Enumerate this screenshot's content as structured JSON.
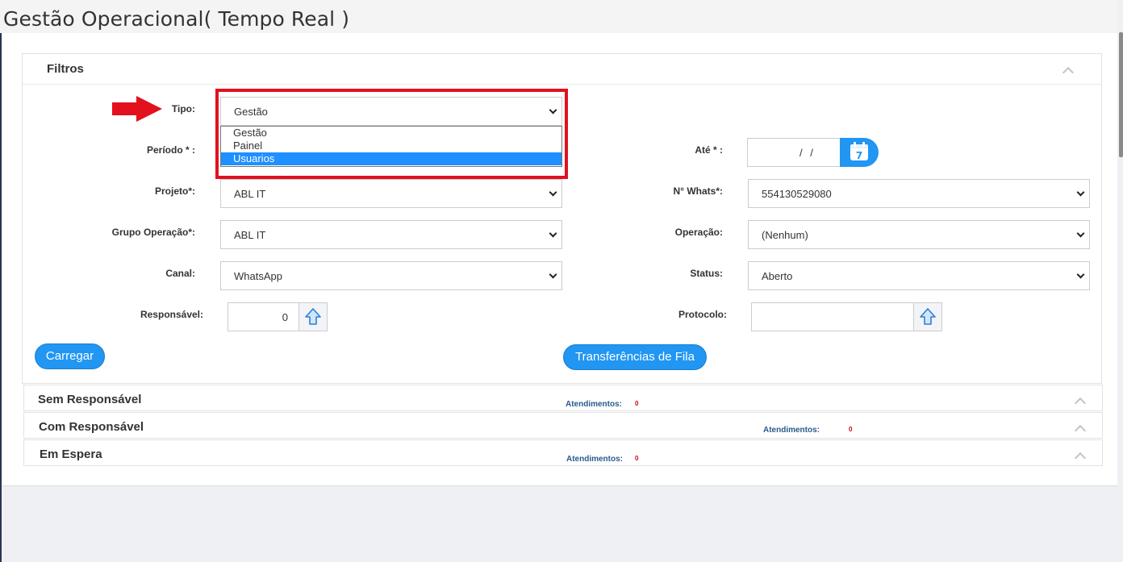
{
  "page": {
    "title": "Gestão Operacional( Tempo Real )"
  },
  "filters": {
    "title": "Filtros",
    "tipo": {
      "label": "Tipo:",
      "value": "Gestão",
      "options": [
        "Gestão",
        "Painel",
        "Usuarios"
      ],
      "highlighted": "Usuarios"
    },
    "periodo": {
      "label": "Período * :"
    },
    "ate": {
      "label": "Até * :",
      "value": "/ /"
    },
    "projeto": {
      "label": "Projeto*:",
      "value": "ABL IT"
    },
    "whats": {
      "label": "N° Whats*:",
      "value": "554130529080"
    },
    "grupo": {
      "label": "Grupo Operação*:",
      "value": "ABL IT"
    },
    "operacao": {
      "label": "Operação:",
      "value": "(Nenhum)"
    },
    "canal": {
      "label": "Canal:",
      "value": "WhatsApp"
    },
    "status": {
      "label": "Status:",
      "value": "Aberto"
    },
    "responsavel": {
      "label": "Responsável:",
      "value": "0"
    },
    "protocolo": {
      "label": "Protocolo:",
      "value": ""
    },
    "calendar_day": "7",
    "load_button": "Carregar",
    "transfer_button": "Transferências de Fila"
  },
  "sections": [
    {
      "title": "Sem Responsável",
      "atendimentos_label": "Atendimentos:",
      "count": "0"
    },
    {
      "title": "Com Responsável",
      "atendimentos_label": "Atendimentos:",
      "count": "0"
    },
    {
      "title": "Em Espera",
      "atendimentos_label": "Atendimentos:",
      "count": "0"
    }
  ],
  "colors": {
    "accent": "#2196f3",
    "highlight": "#e3101d",
    "count": "#d0021b"
  }
}
